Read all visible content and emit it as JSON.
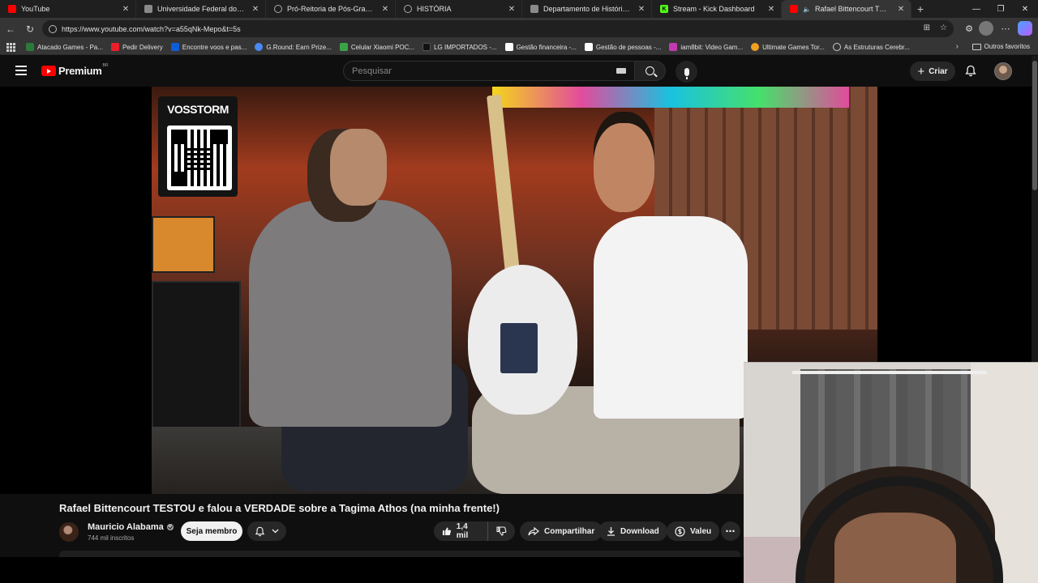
{
  "browser": {
    "tabs": [
      {
        "title": "YouTube",
        "favicon_color": "#ff0000"
      },
      {
        "title": "Universidade Federal do Paraná",
        "favicon_color": "#8a8a8a"
      },
      {
        "title": "Pró-Reitoria de Pós-Graduação",
        "favicon_color": "#8a8a8a"
      },
      {
        "title": "HISTÓRIA",
        "favicon_color": "#8a8a8a"
      },
      {
        "title": "Departamento de História | Unive",
        "favicon_color": "#8a8a8a"
      },
      {
        "title": "Stream - Kick Dashboard",
        "favicon_color": "#53fc18"
      },
      {
        "title": "Rafael Bittencourt TESTOU e",
        "favicon_color": "#ff0000"
      }
    ],
    "url": "https://www.youtube.com/watch?v=a55qNk-Mepo&t=5s",
    "bookmarks": [
      {
        "label": "Atacado Games - Pa...",
        "color": "#2a7a3a"
      },
      {
        "label": "Pedir Delivery",
        "color": "#ea1d2c"
      },
      {
        "label": "Encontre voos e pas...",
        "color": "#0b5ed7"
      },
      {
        "label": "G.Round: Earn Prize...",
        "color": "#4a8af4"
      },
      {
        "label": "Celular Xiaomi POC...",
        "color": "#3aa34a"
      },
      {
        "label": "LG IMPORTADOS -...",
        "color": "#111111"
      },
      {
        "label": "Gestão financeira -...",
        "color": "#ffffff"
      },
      {
        "label": "Gestão de pessoas -...",
        "color": "#ffffff"
      },
      {
        "label": "iam8bit: Video Gam...",
        "color": "#c03ab0"
      },
      {
        "label": "Ultimate Games Tor...",
        "color": "#f0a020"
      },
      {
        "label": "As Estruturas Cerebr...",
        "color": "#cccccc"
      }
    ],
    "other_bookmarks": "Outros favoritos"
  },
  "youtube": {
    "logo_text": "Premium",
    "region": "BR",
    "search_placeholder": "Pesquisar",
    "create_label": "Criar"
  },
  "video": {
    "overlay_brand": "VOSSTORM",
    "title": "Rafael Bittencourt TESTOU e falou a VERDADE sobre a Tagima Athos (na minha frente!)",
    "channel_name": "Mauricio Alabama",
    "subscribers": "744 mil inscritos",
    "join_label": "Seja membro",
    "like_count": "1,4 mil",
    "share_label": "Compartilhar",
    "download_label": "Download",
    "thanks_label": "Valeu"
  }
}
